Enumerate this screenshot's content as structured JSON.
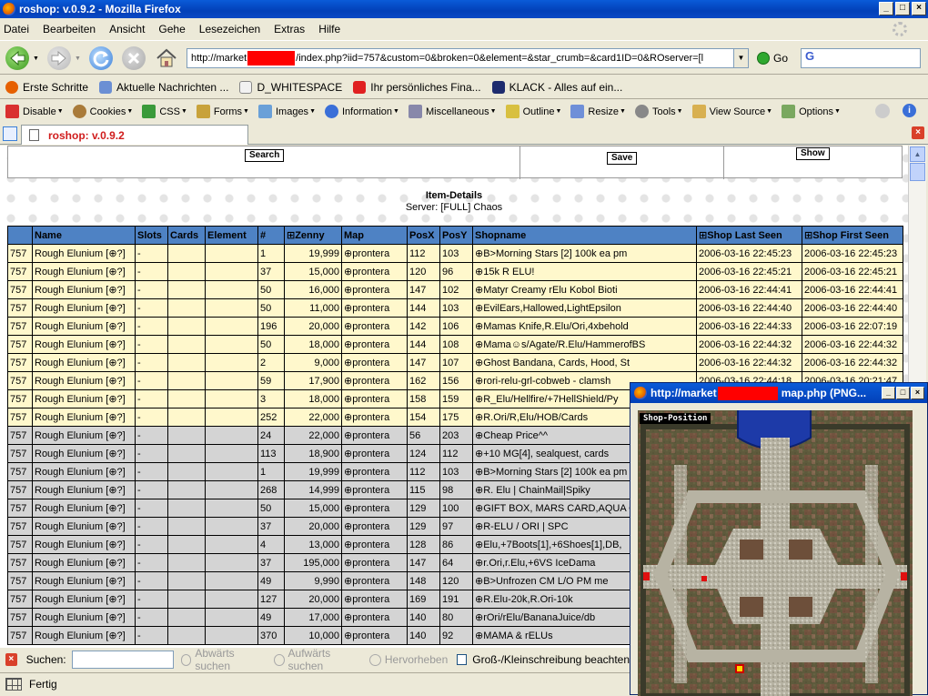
{
  "window": {
    "title": "roshop: v.0.9.2 - Mozilla Firefox",
    "minimize": "_",
    "maximize": "□",
    "close": "×"
  },
  "menu": [
    "Datei",
    "Bearbeiten",
    "Ansicht",
    "Gehe",
    "Lesezeichen",
    "Extras",
    "Hilfe"
  ],
  "nav": {
    "url_prefix": "http://market",
    "url_suffix": "/index.php?iid=757&custom=0&broken=0&element=&star_crumb=&card1ID=0&ROserver=[l",
    "go_label": "Go",
    "search_logo": "G"
  },
  "bookmarks": [
    {
      "label": "Erste Schritte",
      "color": "#e66000"
    },
    {
      "label": "Aktuelle Nachrichten ...",
      "color": "#6b8fd4"
    },
    {
      "label": "D_WHITESPACE",
      "color": "#f2f2f2"
    },
    {
      "label": "Ihr persönliches Fina...",
      "color": "#e02020"
    },
    {
      "label": "KLACK - Alles auf ein...",
      "color": "#1d2b6e"
    }
  ],
  "devbar": [
    {
      "label": "Disable",
      "color": "#d93030"
    },
    {
      "label": "Cookies",
      "color": "#a97b3a"
    },
    {
      "label": "CSS",
      "color": "#3a9a3a"
    },
    {
      "label": "Forms",
      "color": "#c8a23a"
    },
    {
      "label": "Images",
      "color": "#6aa0d8"
    },
    {
      "label": "Information",
      "color": "#3a6fd8"
    },
    {
      "label": "Miscellaneous",
      "color": "#8888aa"
    },
    {
      "label": "Outline",
      "color": "#d8c040"
    },
    {
      "label": "Resize",
      "color": "#6f8fd8"
    },
    {
      "label": "Tools",
      "color": "#888888"
    },
    {
      "label": "View Source",
      "color": "#d8b050"
    },
    {
      "label": "Options",
      "color": "#7aa860"
    }
  ],
  "tab": {
    "label": "roshop: v.0.9.2"
  },
  "form": {
    "search": "Search",
    "save": "Save",
    "show": "Show"
  },
  "details": {
    "title": "Item-Details",
    "server": "Server: [FULL] Chaos"
  },
  "table": {
    "headers": [
      "",
      "Name",
      "Slots",
      "Cards",
      "Element",
      "#",
      "⊞Zenny",
      "Map",
      "PosX",
      "PosY",
      "Shopname",
      "⊞Shop Last Seen",
      "⊞Shop First Seen"
    ],
    "rows": [
      [
        "757",
        "Rough Elunium [⊕?]",
        "-",
        "",
        "",
        "1",
        "19,999",
        "⊕prontera",
        "112",
        "103",
        "⊕B>Morning Stars [2] 100k ea pm",
        "2006-03-16 22:45:23",
        "2006-03-16 22:45:23",
        "y"
      ],
      [
        "757",
        "Rough Elunium [⊕?]",
        "-",
        "",
        "",
        "37",
        "15,000",
        "⊕prontera",
        "120",
        "96",
        "⊕15k R ELU!",
        "2006-03-16 22:45:21",
        "2006-03-16 22:45:21",
        "y"
      ],
      [
        "757",
        "Rough Elunium [⊕?]",
        "-",
        "",
        "",
        "50",
        "16,000",
        "⊕prontera",
        "147",
        "102",
        "⊕Matyr Creamy rElu Kobol Bioti",
        "2006-03-16 22:44:41",
        "2006-03-16 22:44:41",
        "y"
      ],
      [
        "757",
        "Rough Elunium [⊕?]",
        "-",
        "",
        "",
        "50",
        "11,000",
        "⊕prontera",
        "144",
        "103",
        "⊕EvilEars,Hallowed,LightEpsilon",
        "2006-03-16 22:44:40",
        "2006-03-16 22:44:40",
        "y"
      ],
      [
        "757",
        "Rough Elunium [⊕?]",
        "-",
        "",
        "",
        "196",
        "20,000",
        "⊕prontera",
        "142",
        "106",
        "⊕Mamas Knife,R.Elu/Ori,4xbehold",
        "2006-03-16 22:44:33",
        "2006-03-16 22:07:19",
        "y"
      ],
      [
        "757",
        "Rough Elunium [⊕?]",
        "-",
        "",
        "",
        "50",
        "18,000",
        "⊕prontera",
        "144",
        "108",
        "⊕Mama☺s/Agate/R.Elu/HammerofBS",
        "2006-03-16 22:44:32",
        "2006-03-16 22:44:32",
        "y"
      ],
      [
        "757",
        "Rough Elunium [⊕?]",
        "-",
        "",
        "",
        "2",
        "9,000",
        "⊕prontera",
        "147",
        "107",
        "⊕Ghost Bandana, Cards, Hood, St",
        "2006-03-16 22:44:32",
        "2006-03-16 22:44:32",
        "y"
      ],
      [
        "757",
        "Rough Elunium [⊕?]",
        "-",
        "",
        "",
        "59",
        "17,900",
        "⊕prontera",
        "162",
        "156",
        "⊕rori-relu-grl-cobweb - clamsh",
        "2006-03-16 22:44:18",
        "2006-03-16 20:21:47",
        "y"
      ],
      [
        "757",
        "Rough Elunium [⊕?]",
        "-",
        "",
        "",
        "3",
        "18,000",
        "⊕prontera",
        "158",
        "159",
        "⊕R_Elu/Hellfire/+7HellShield/Py",
        "",
        "",
        "y"
      ],
      [
        "757",
        "Rough Elunium [⊕?]",
        "-",
        "",
        "",
        "252",
        "22,000",
        "⊕prontera",
        "154",
        "175",
        "⊕R.Ori/R,Elu/HOB/Cards",
        "",
        "",
        "y"
      ],
      [
        "757",
        "Rough Elunium [⊕?]",
        "-",
        "",
        "",
        "24",
        "22,000",
        "⊕prontera",
        "56",
        "203",
        "⊕Cheap Price^^",
        "",
        "",
        "g"
      ],
      [
        "757",
        "Rough Elunium [⊕?]",
        "-",
        "",
        "",
        "113",
        "18,900",
        "⊕prontera",
        "124",
        "112",
        "⊕+10 MG[4], sealquest, cards",
        "",
        "",
        "g"
      ],
      [
        "757",
        "Rough Elunium [⊕?]",
        "-",
        "",
        "",
        "1",
        "19,999",
        "⊕prontera",
        "112",
        "103",
        "⊕B>Morning Stars [2] 100k ea pm",
        "",
        "",
        "g"
      ],
      [
        "757",
        "Rough Elunium [⊕?]",
        "-",
        "",
        "",
        "268",
        "14,999",
        "⊕prontera",
        "115",
        "98",
        "⊕R. Elu | ChainMail|Spiky",
        "",
        "",
        "g"
      ],
      [
        "757",
        "Rough Elunium [⊕?]",
        "-",
        "",
        "",
        "50",
        "15,000",
        "⊕prontera",
        "129",
        "100",
        "⊕GIFT BOX, MARS CARD,AQUA C",
        "",
        "",
        "g"
      ],
      [
        "757",
        "Rough Elunium [⊕?]",
        "-",
        "",
        "",
        "37",
        "20,000",
        "⊕prontera",
        "129",
        "97",
        "⊕R-ELU / ORI | SPC",
        "",
        "",
        "g"
      ],
      [
        "757",
        "Rough Elunium [⊕?]",
        "-",
        "",
        "",
        "4",
        "13,000",
        "⊕prontera",
        "128",
        "86",
        "⊕Elu,+7Boots[1],+6Shoes[1],DB,",
        "",
        "",
        "g"
      ],
      [
        "757",
        "Rough Elunium [⊕?]",
        "-",
        "",
        "",
        "37",
        "195,000",
        "⊕prontera",
        "147",
        "64",
        "⊕r.Ori,r.Elu,+6VS IceDama",
        "",
        "",
        "g"
      ],
      [
        "757",
        "Rough Elunium [⊕?]",
        "-",
        "",
        "",
        "49",
        "9,990",
        "⊕prontera",
        "148",
        "120",
        "⊕B>Unfrozen CM L/O PM me",
        "",
        "",
        "g"
      ],
      [
        "757",
        "Rough Elunium [⊕?]",
        "-",
        "",
        "",
        "127",
        "20,000",
        "⊕prontera",
        "169",
        "191",
        "⊕R.Elu-20k,R.Ori-10k",
        "",
        "",
        "g"
      ],
      [
        "757",
        "Rough Elunium [⊕?]",
        "-",
        "",
        "",
        "49",
        "17,000",
        "⊕prontera",
        "140",
        "80",
        "⊕rOri/rElu/BananaJuice/db",
        "",
        "",
        "g"
      ],
      [
        "757",
        "Rough Elunium [⊕?]",
        "-",
        "",
        "",
        "370",
        "10,000",
        "⊕prontera",
        "140",
        "92",
        "⊕MAMA & rELUs",
        "",
        "",
        "g"
      ]
    ]
  },
  "find": {
    "label": "Suchen:",
    "down": "Abwärts suchen",
    "up": "Aufwärts suchen",
    "highlight": "Hervorheben",
    "case": "Groß-/Kleinschreibung beachten"
  },
  "status": {
    "text": "Fertig"
  },
  "popup": {
    "title_prefix": "http://market",
    "title_suffix": "map.php (PNG...",
    "map_label": "Shop-Position"
  }
}
